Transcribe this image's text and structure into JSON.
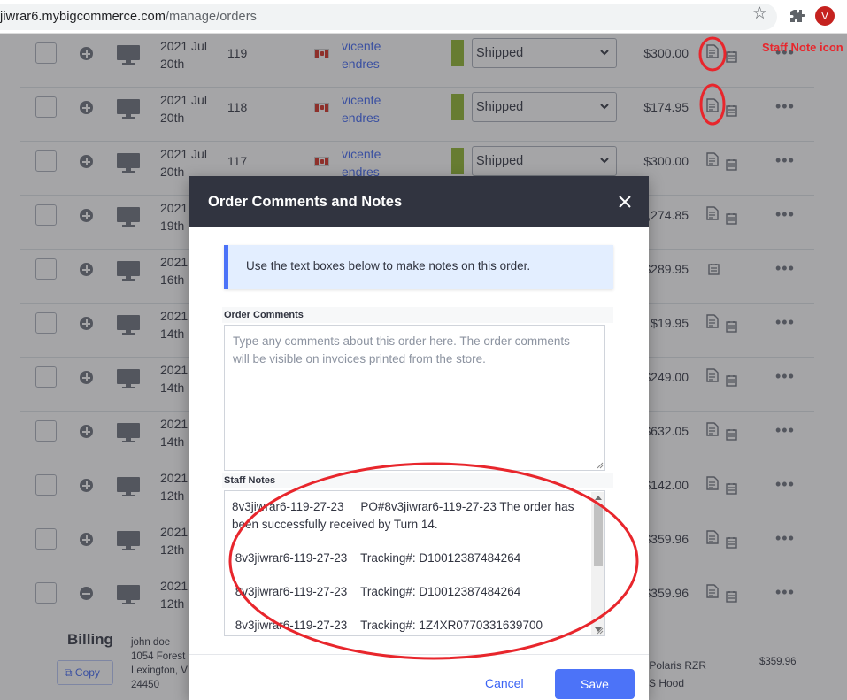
{
  "browser": {
    "url_host": "jiwrar6.mybigcommerce.com",
    "url_path": "/manage/orders",
    "avatar_letter": "V"
  },
  "orders": [
    {
      "date_line1": "2021 Jul",
      "date_line2": "20th",
      "id": "119",
      "customer_line1": "vicente",
      "customer_line2": "endres",
      "status": "Shipped",
      "amount": "$300.00",
      "expand": "plus",
      "notes_icon": true
    },
    {
      "date_line1": "2021 Jul",
      "date_line2": "20th",
      "id": "118",
      "customer_line1": "vicente",
      "customer_line2": "endres",
      "status": "Shipped",
      "amount": "$174.95",
      "expand": "plus",
      "notes_icon": true
    },
    {
      "date_line1": "2021 Jul",
      "date_line2": "20th",
      "id": "117",
      "customer_line1": "vicente",
      "customer_line2": "endres",
      "status": "Shipped",
      "amount": "$300.00",
      "expand": "plus",
      "notes_icon": true
    },
    {
      "date_line1": "2021",
      "date_line2": "19th",
      "id": "",
      "customer_line1": "",
      "customer_line2": "",
      "status": "",
      "amount": ",274.85",
      "expand": "plus",
      "notes_icon": true
    },
    {
      "date_line1": "2021",
      "date_line2": "16th",
      "id": "",
      "customer_line1": "",
      "customer_line2": "",
      "status": "",
      "amount": "$289.95",
      "expand": "plus",
      "notes_icon": false
    },
    {
      "date_line1": "2021",
      "date_line2": "14th",
      "id": "",
      "customer_line1": "",
      "customer_line2": "",
      "status": "",
      "amount": "$19.95",
      "expand": "plus",
      "notes_icon": true
    },
    {
      "date_line1": "2021",
      "date_line2": "14th",
      "id": "",
      "customer_line1": "",
      "customer_line2": "",
      "status": "",
      "amount": "$249.00",
      "expand": "plus",
      "notes_icon": true
    },
    {
      "date_line1": "2021",
      "date_line2": "14th",
      "id": "",
      "customer_line1": "",
      "customer_line2": "",
      "status": "",
      "amount": "$632.05",
      "expand": "plus",
      "notes_icon": true
    },
    {
      "date_line1": "2021",
      "date_line2": "12th",
      "id": "",
      "customer_line1": "",
      "customer_line2": "",
      "status": "",
      "amount": "$142.00",
      "expand": "plus",
      "notes_icon": true
    },
    {
      "date_line1": "2021",
      "date_line2": "12th",
      "id": "",
      "customer_line1": "",
      "customer_line2": "",
      "status": "",
      "amount": "$359.96",
      "expand": "plus",
      "notes_icon": true
    },
    {
      "date_line1": "2021",
      "date_line2": "12th",
      "id": "",
      "customer_line1": "",
      "customer_line2": "",
      "status": "",
      "amount": "$359.96",
      "expand": "minus",
      "notes_icon": true
    }
  ],
  "billing": {
    "title": "Billing",
    "copy_label": "Copy",
    "address_lines": [
      "john doe",
      "1054 Forest",
      "Lexington, V",
      "24450"
    ],
    "item_line1": "+ Polaris RZR",
    "item_line2": "o S Hood",
    "item_price": "$359.96"
  },
  "modal": {
    "title": "Order Comments and Notes",
    "info": "Use the text boxes below to make notes on this order.",
    "comments_label": "Order Comments",
    "comments_placeholder_line1": "Type any comments about this order here. The order comments",
    "comments_placeholder_line2": "will be visible on invoices printed from the store.",
    "notes_label": "Staff Notes",
    "notes_lines": [
      "8v3jiwrar6-119-27-23     PO#8v3jiwrar6-119-27-23 The order has",
      "been successfully received by Turn 14.",
      "",
      " 8v3jiwrar6-119-27-23    Tracking#: D10012387484264",
      "",
      " 8v3jiwrar6-119-27-23    Tracking#: D10012387484264",
      "",
      " 8v3jiwrar6-119-27-23    Tracking#: 1Z4XR0770331639700"
    ],
    "cancel_label": "Cancel",
    "save_label": "Save"
  },
  "annotation": {
    "label": "Staff Note icon",
    "color": "#e8262c"
  }
}
